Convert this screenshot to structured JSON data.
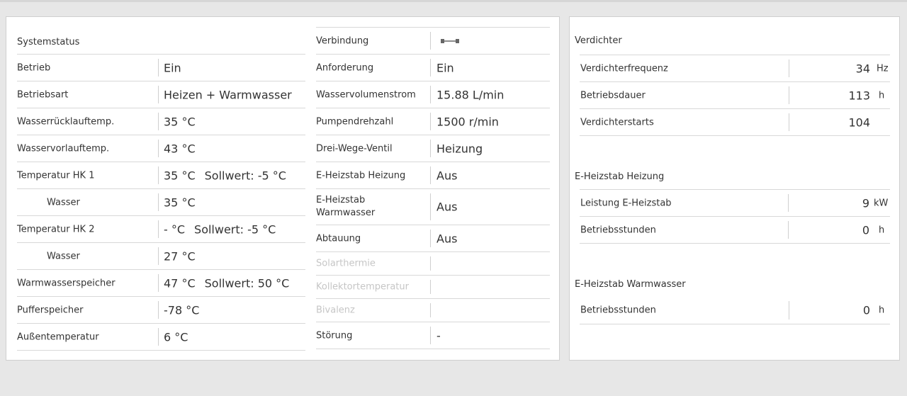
{
  "systemstatus": {
    "title": "Systemstatus",
    "rows": [
      {
        "label": "Betrieb",
        "value": "Ein"
      },
      {
        "label": "Betriebsart",
        "value": "Heizen + Warmwasser"
      },
      {
        "label": "Wasserrücklauftemp.",
        "value": "35 °C"
      },
      {
        "label": "Wasservorlauftemp.",
        "value": "43 °C"
      },
      {
        "label": "Temperatur HK 1",
        "value": "35 °C",
        "setpoint": "Sollwert: -5 °C"
      },
      {
        "label": "Wasser",
        "value": "35 °C"
      },
      {
        "label": "Temperatur HK 2",
        "value": "- °C",
        "setpoint": "Sollwert: -5 °C"
      },
      {
        "label": "Wasser",
        "value": "27 °C"
      },
      {
        "label": "Warmwasserspeicher",
        "value": "47 °C",
        "setpoint": "Sollwert: 50 °C"
      },
      {
        "label": "Pufferspeicher",
        "value": "-78 °C"
      },
      {
        "label": "Außentemperatur",
        "value": "6 °C"
      }
    ]
  },
  "middle": {
    "rows": [
      {
        "label": "Verbindung",
        "icon": "connection-icon"
      },
      {
        "label": "Anforderung",
        "value": "Ein"
      },
      {
        "label": "Wasservolumenstrom",
        "value": "15.88 L/min"
      },
      {
        "label": "Pumpendrehzahl",
        "value": "1500 r/min"
      },
      {
        "label": "Drei-Wege-Ventil",
        "value": "Heizung"
      },
      {
        "label": "E-Heizstab Heizung",
        "value": "Aus"
      },
      {
        "label": "E-Heizstab Warmwasser",
        "value": "Aus"
      },
      {
        "label": "Abtauung",
        "value": "Aus"
      },
      {
        "label": "Solarthermie",
        "value": ""
      },
      {
        "label": "Kollektortemperatur",
        "value": ""
      },
      {
        "label": "Bivalenz",
        "value": ""
      },
      {
        "label": "Störung",
        "value": "-"
      }
    ]
  },
  "verdichter": {
    "title": "Verdichter",
    "rows": [
      {
        "label": "Verdichterfrequenz",
        "value": "34",
        "unit": "Hz"
      },
      {
        "label": "Betriebsdauer",
        "value": "113",
        "unit": "h"
      },
      {
        "label": "Verdichterstarts",
        "value": "104",
        "unit": ""
      }
    ]
  },
  "heizstab_heizung": {
    "title": "E-Heizstab Heizung",
    "rows": [
      {
        "label": "Leistung E-Heizstab",
        "value": "9",
        "unit": "kW"
      },
      {
        "label": "Betriebsstunden",
        "value": "0",
        "unit": "h"
      }
    ]
  },
  "heizstab_warmwasser": {
    "title": "E-Heizstab Warmwasser",
    "rows": [
      {
        "label": "Betriebsstunden",
        "value": "0",
        "unit": "h"
      }
    ]
  },
  "colors": {
    "background": "#e7e7e7",
    "panel": "#ffffff",
    "divider": "#d8d8d8",
    "disabled_text": "#c6c6c6"
  }
}
